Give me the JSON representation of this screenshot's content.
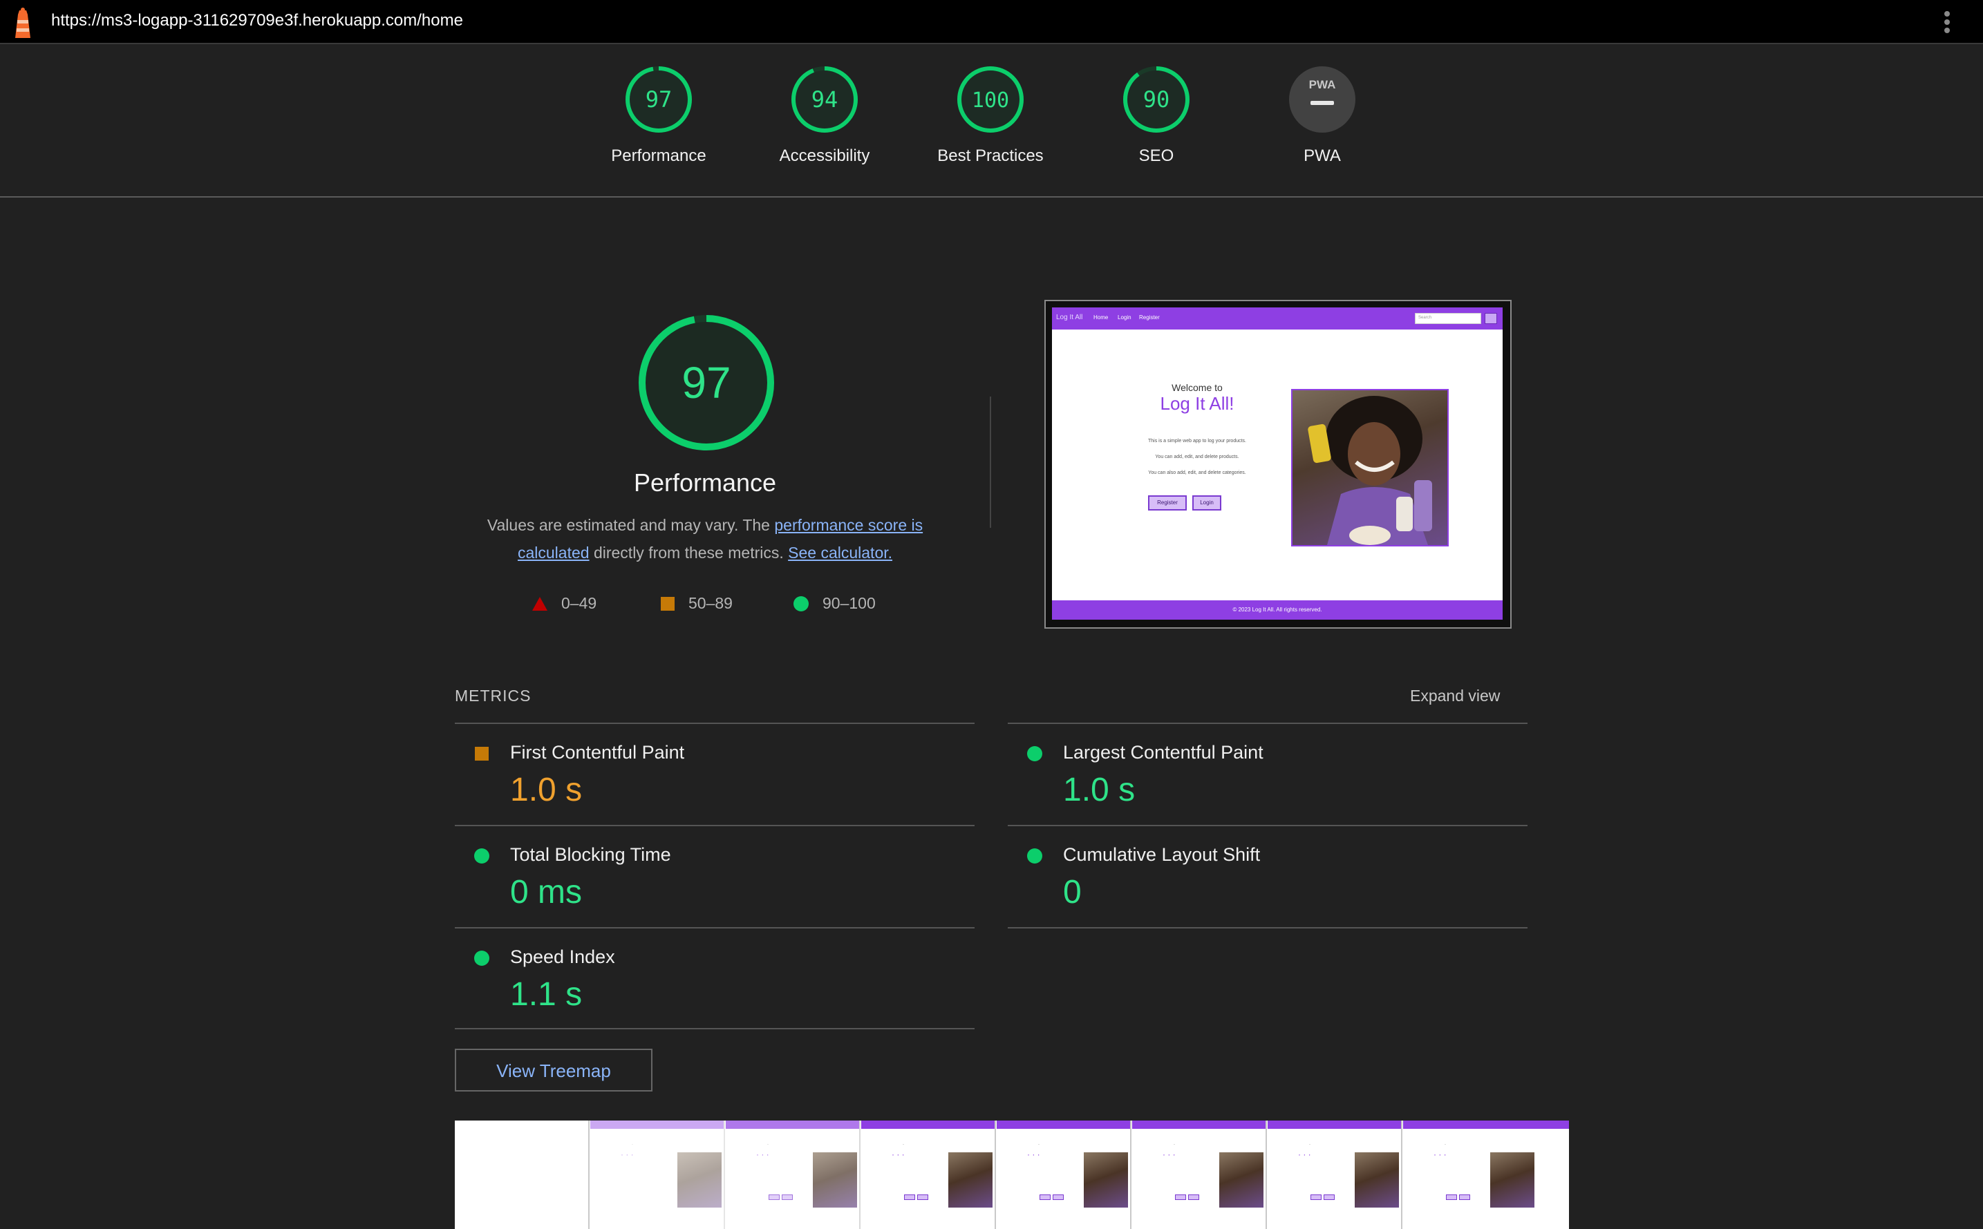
{
  "url_bar": {
    "url": "https://ms3-logapp-311629709e3f.herokuapp.com/home",
    "icon": "lighthouse-icon"
  },
  "categories": [
    {
      "score": "97",
      "label": "Performance",
      "value": 97
    },
    {
      "score": "94",
      "label": "Accessibility",
      "value": 94
    },
    {
      "score": "100",
      "label": "Best Practices",
      "value": 100
    },
    {
      "score": "90",
      "label": "SEO",
      "value": 90
    },
    {
      "score": "PWA",
      "label": "PWA",
      "value": null
    }
  ],
  "performance": {
    "score": "97",
    "value": 97,
    "title": "Performance",
    "desc_prefix": "Values are estimated and may vary. The ",
    "desc_link1": "performance score is calculated",
    "desc_mid": " directly from these metrics. ",
    "desc_link2": "See calculator.",
    "legend": [
      {
        "range": "0–49",
        "color": "#c00000"
      },
      {
        "range": "50–89",
        "color": "#c67a07"
      },
      {
        "range": "90–100",
        "color": "#0cce6b"
      }
    ]
  },
  "preview": {
    "brand": "Log It All",
    "nav": [
      "Home",
      "Login",
      "Register"
    ],
    "search_placeholder": "Search",
    "welcome": "Welcome to",
    "title": "Log It All!",
    "lines": [
      "This is a simple web app to log your products.",
      "You can add, edit, and delete products.",
      "You can also add, edit, and delete categories."
    ],
    "register": "Register",
    "login": "Login",
    "footer": "© 2023 Log It All. All rights reserved."
  },
  "metrics": {
    "heading": "METRICS",
    "expand": "Expand view",
    "items": [
      {
        "name": "First Contentful Paint",
        "value": "1.0 s",
        "rating": "average"
      },
      {
        "name": "Largest Contentful Paint",
        "value": "1.0 s",
        "rating": "pass"
      },
      {
        "name": "Total Blocking Time",
        "value": "0 ms",
        "rating": "pass"
      },
      {
        "name": "Cumulative Layout Shift",
        "value": "0",
        "rating": "pass"
      },
      {
        "name": "Speed Index",
        "value": "1.1 s",
        "rating": "pass"
      }
    ]
  },
  "treemap_button": "View Treemap",
  "colors": {
    "pass": "#0cce6b",
    "pass_text": "#2fe389",
    "average": "#c67a07",
    "average_text": "#f0a12e",
    "fail": "#c00000",
    "brand_purple": "#8e3fe3",
    "link": "#8ab4f8"
  }
}
